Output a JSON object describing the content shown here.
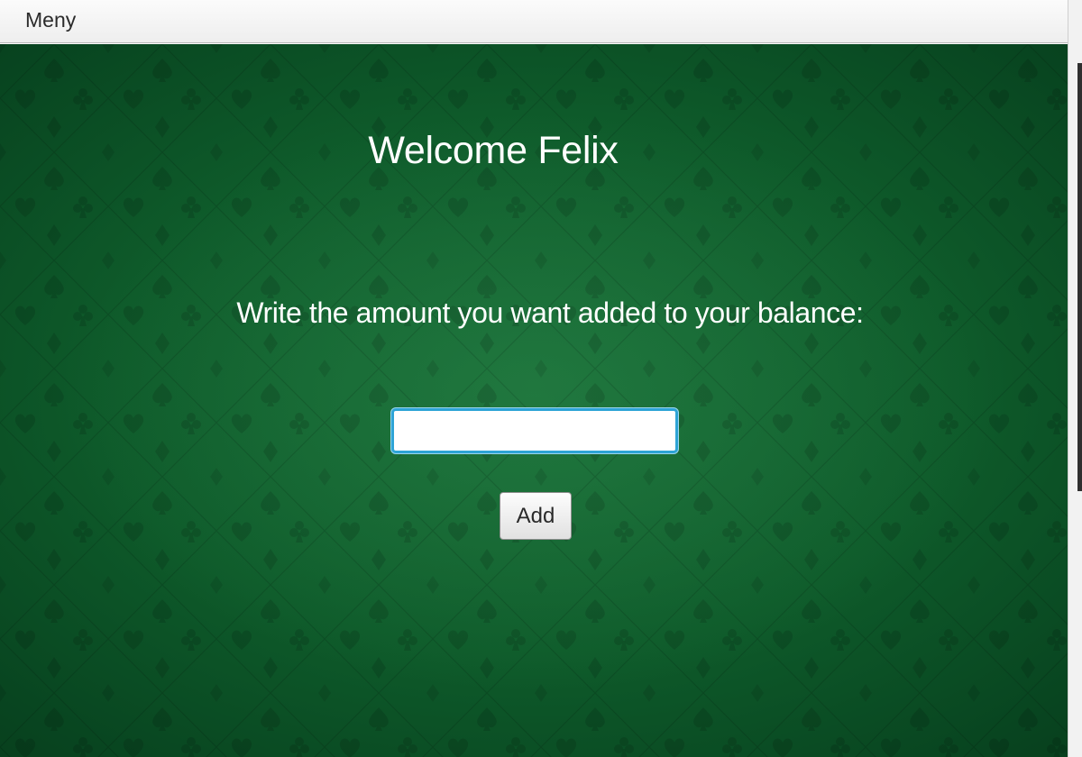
{
  "menubar": {
    "menu_label": "Meny"
  },
  "main": {
    "welcome_text": "Welcome Felix",
    "instruction_text": "Write the amount you want added to your balance:",
    "amount_input": {
      "value": "",
      "placeholder": ""
    },
    "add_button_label": "Add"
  },
  "background": {
    "pattern": "card-suits-felt",
    "icons": [
      "spade-icon",
      "heart-icon",
      "club-icon",
      "diamond-icon"
    ]
  },
  "colors": {
    "felt_green": "#0e5a2a",
    "input_focus_border": "#2ea4d6",
    "text": "#ffffff"
  }
}
